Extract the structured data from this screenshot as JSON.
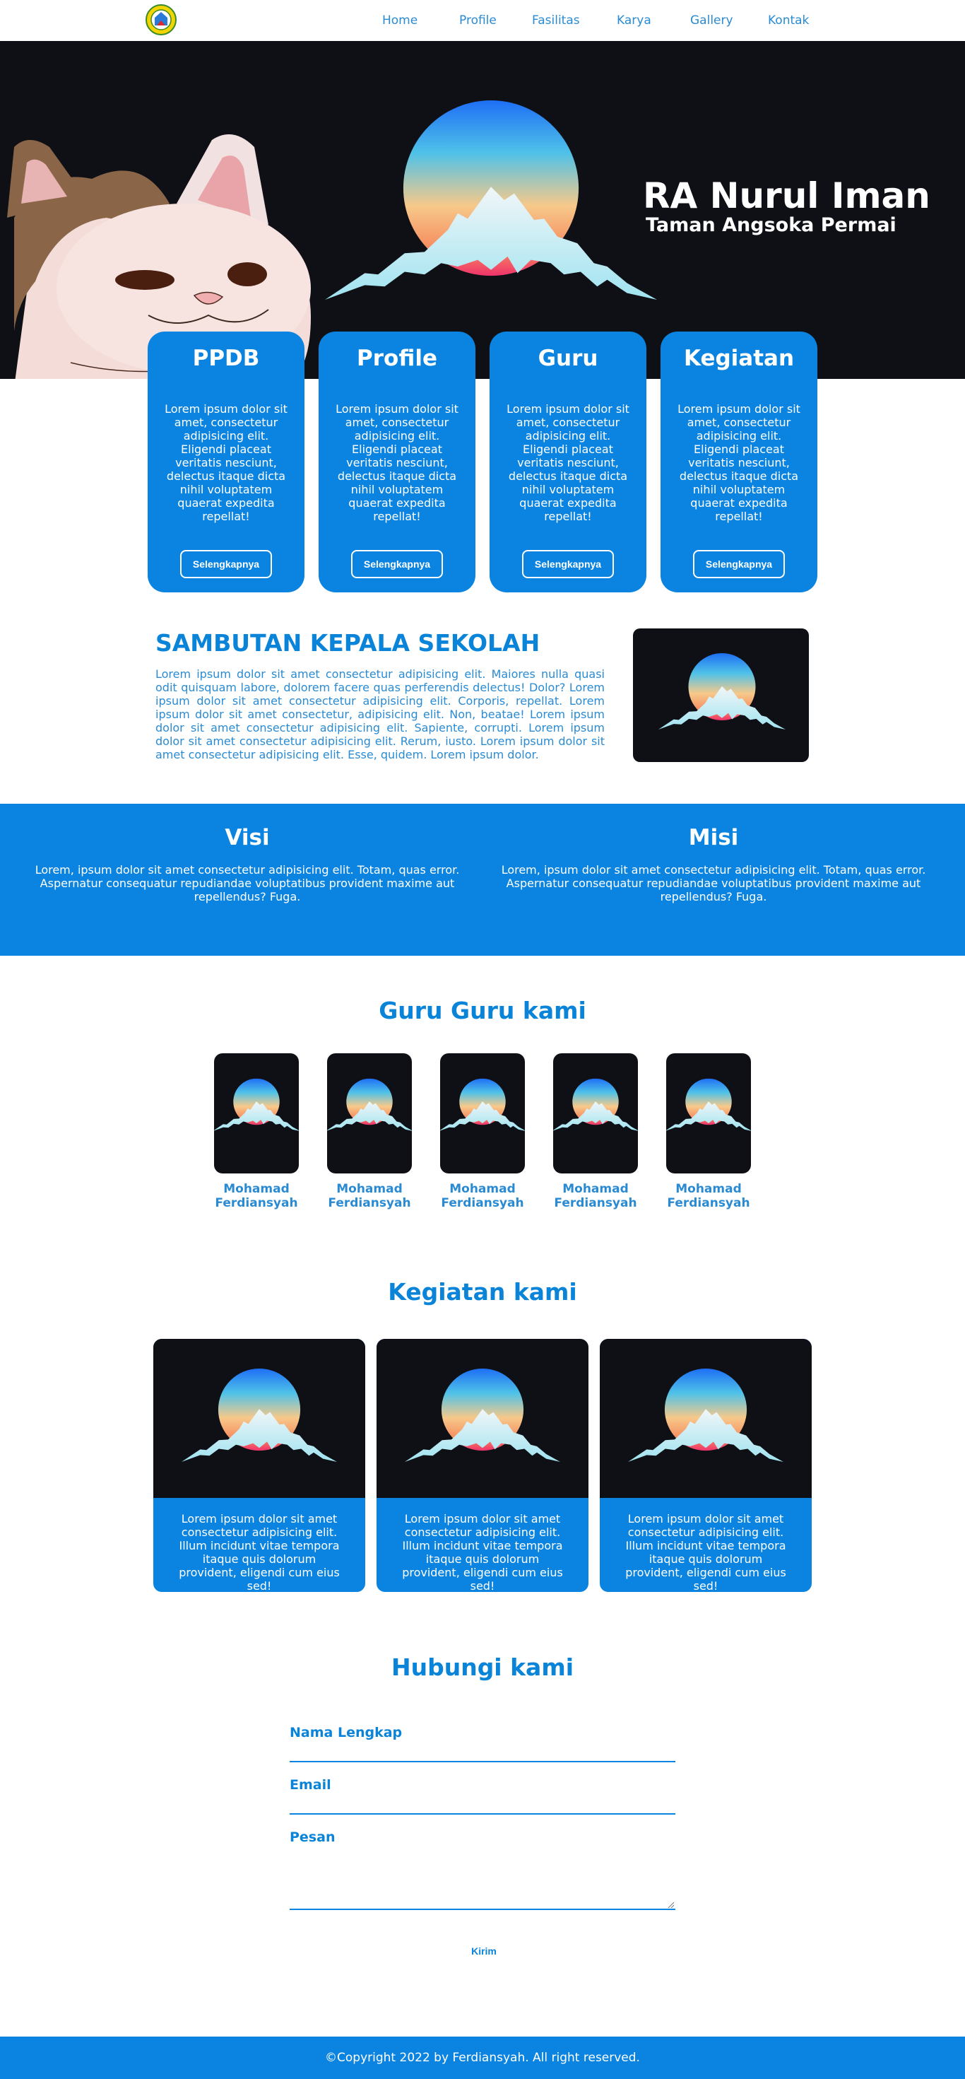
{
  "nav": {
    "logo_icon": "school-emblem-icon",
    "links": [
      "Home",
      "Profile",
      "Fasilitas",
      "Karya",
      "Gallery",
      "Kontak"
    ]
  },
  "hero": {
    "title": "RA Nurul Iman",
    "subtitle": "Taman Angsoka Permai"
  },
  "cards": [
    {
      "title": "PPDB",
      "text": "Lorem ipsum dolor sit amet, consectetur adipisicing elit. Eligendi placeat veritatis nesciunt, delectus itaque dicta nihil voluptatem quaerat expedita repellat!",
      "button": "Selengkapnya"
    },
    {
      "title": "Profile",
      "text": "Lorem ipsum dolor sit amet, consectetur adipisicing elit. Eligendi placeat veritatis nesciunt, delectus itaque dicta nihil voluptatem quaerat expedita repellat!",
      "button": "Selengkapnya"
    },
    {
      "title": "Guru",
      "text": "Lorem ipsum dolor sit amet, consectetur adipisicing elit. Eligendi placeat veritatis nesciunt, delectus itaque dicta nihil voluptatem quaerat expedita repellat!",
      "button": "Selengkapnya"
    },
    {
      "title": "Kegiatan",
      "text": "Lorem ipsum dolor sit amet, consectetur adipisicing elit. Eligendi placeat veritatis nesciunt, delectus itaque dicta nihil voluptatem quaerat expedita repellat!",
      "button": "Selengkapnya"
    }
  ],
  "sambutan": {
    "title": "SAMBUTAN KEPALA SEKOLAH",
    "text": "Lorem ipsum dolor sit amet consectetur adipisicing elit. Maiores nulla quasi odit quisquam labore, dolorem facere quas perferendis delectus! Dolor? Lorem ipsum dolor sit amet consectetur adipisicing elit. Corporis, repellat. Lorem ipsum dolor sit amet consectetur, adipisicing elit. Non, beatae! Lorem ipsum dolor sit amet consectetur adipisicing elit. Sapiente, corrupti. Lorem ipsum dolor sit amet consectetur adipisicing elit. Rerum, iusto. Lorem ipsum dolor sit amet consectetur adipisicing elit. Esse, quidem. Lorem ipsum dolor."
  },
  "visi": {
    "title": "Visi",
    "text": "Lorem, ipsum dolor sit amet consectetur adipisicing elit. Totam, quas error. Aspernatur consequatur repudiandae voluptatibus provident maxime aut repellendus? Fuga."
  },
  "misi": {
    "title": "Misi",
    "text": "Lorem, ipsum dolor sit amet consectetur adipisicing elit. Totam, quas error. Aspernatur consequatur repudiandae voluptatibus provident maxime aut repellendus? Fuga."
  },
  "guru": {
    "title": "Guru Guru kami",
    "members": [
      "Mohamad Ferdiansyah",
      "Mohamad Ferdiansyah",
      "Mohamad Ferdiansyah",
      "Mohamad Ferdiansyah",
      "Mohamad Ferdiansyah"
    ]
  },
  "kegiatan": {
    "title": "Kegiatan kami",
    "items": [
      "Lorem ipsum dolor sit amet consectetur adipisicing elit. Illum incidunt vitae tempora itaque quis dolorum provident, eligendi cum eius sed!",
      "Lorem ipsum dolor sit amet consectetur adipisicing elit. Illum incidunt vitae tempora itaque quis dolorum provident, eligendi cum eius sed!",
      "Lorem ipsum dolor sit amet consectetur adipisicing elit. Illum incidunt vitae tempora itaque quis dolorum provident, eligendi cum eius sed!"
    ]
  },
  "contact": {
    "title": "Hubungi kami",
    "name_label": "Nama Lengkap",
    "email_label": "Email",
    "message_label": "Pesan",
    "submit": "Kirim"
  },
  "footer": {
    "text": "©Copyright 2022 by Ferdiansyah. All right reserved."
  },
  "colors": {
    "primary": "#0a84e0",
    "dark": "#0e1016",
    "white": "#ffffff"
  }
}
